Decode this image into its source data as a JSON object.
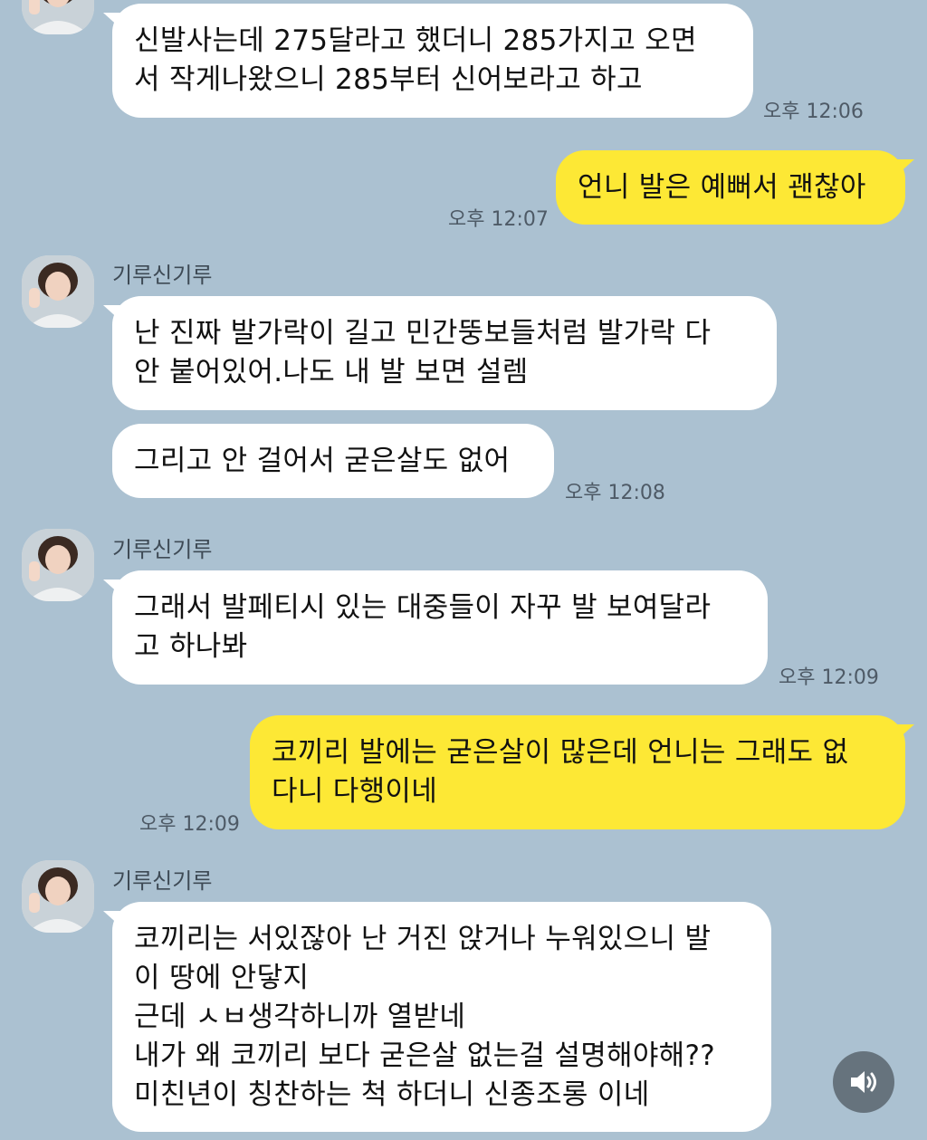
{
  "messages": [
    {
      "side": "in",
      "lines": [
        "신발사는데 275달라고 했더니 285가지고 오면",
        "서 작게나왔으니 285부터 신어보라고 하고"
      ],
      "time": "오후 12:06"
    },
    {
      "side": "out",
      "lines": [
        "언니 발은 예뻐서 괜찮아"
      ],
      "time": "오후 12:07"
    },
    {
      "side": "in",
      "sender": "기루신기루",
      "lines": [
        "난 진짜 발가락이 길고 민간뚱보들처럼 발가락 다",
        "안 붙어있어.나도 내 발 보면 설렘"
      ]
    },
    {
      "side": "in",
      "lines": [
        "그리고 안 걸어서 굳은살도 없어"
      ],
      "time": "오후 12:08"
    },
    {
      "side": "in",
      "sender": "기루신기루",
      "lines": [
        "그래서 발페티시 있는 대중들이 자꾸 발 보여달라",
        "고 하나봐"
      ],
      "time": "오후 12:09"
    },
    {
      "side": "out",
      "lines": [
        "코끼리 발에는 굳은살이 많은데 언니는 그래도 없",
        "다니 다행이네"
      ],
      "time": "오후 12:09"
    },
    {
      "side": "in",
      "sender": "기루신기루",
      "lines": [
        "코끼리는 서있잖아 난 거진 앉거나 누워있으니 발",
        "이 땅에 안닿지",
        "근데 ㅅㅂ생각하니까 열받네",
        "내가 왜 코끼리 보다 굳은살 없는걸 설명해야해??",
        "미친년이 칭찬하는 척 하더니 신종조롱 이네"
      ]
    }
  ],
  "icons": {
    "speaker": "speaker-icon",
    "avatar": "avatar-icon"
  },
  "colors": {
    "background": "#abc1d1",
    "incoming": "#ffffff",
    "outgoing": "#fde835"
  }
}
